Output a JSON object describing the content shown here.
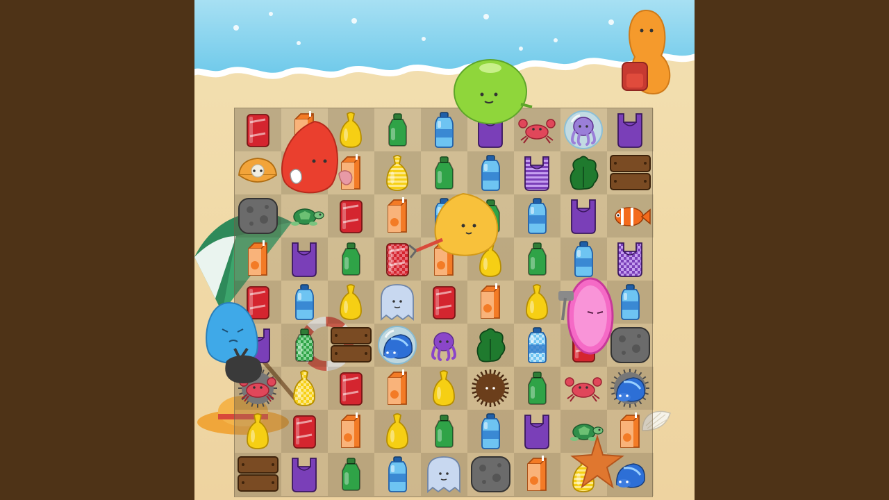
{
  "colors": {
    "frame": "#4e3317",
    "sand": "#f0d9a6",
    "sea": "#7fd1ef",
    "foam": "#ffffff"
  },
  "board": {
    "rows": 9,
    "cols": 9,
    "grid": [
      [
        "red-can",
        "orange-juice-box",
        "yellow-bag",
        "green-bottle",
        "blue-water-bottle",
        "purple-bag",
        "red-crab",
        "octopus-in-bubble",
        "purple-bag"
      ],
      [
        "clam-with-pearl",
        "orange-juice-box",
        "orange-juice-box",
        "yellow-striped-bag",
        "green-bottle",
        "blue-water-bottle",
        "purple-striped-bag",
        "green-seaweed",
        "wooden-plank"
      ],
      [
        "gray-rock",
        "sea-turtle",
        "red-can",
        "orange-juice-box",
        "blue-water-bottle",
        "green-bottle",
        "blue-water-bottle",
        "purple-bag",
        "clownfish"
      ],
      [
        "orange-juice-box",
        "purple-bag",
        "green-bottle",
        "red-can-checkered",
        "orange-juice-box",
        "yellow-bag",
        "green-bottle",
        "blue-water-bottle",
        "purple-bag-checkered"
      ],
      [
        "red-can",
        "blue-water-bottle",
        "yellow-bag",
        "ghost-jellyfish",
        "red-can",
        "orange-juice-box",
        "yellow-bag",
        "blue-water-bottle",
        "blue-water-bottle"
      ],
      [
        "purple-bag",
        "green-bottle-checkered",
        "wooden-plank",
        "hermit-crab-in-bubble",
        "purple-octopus",
        "green-seaweed",
        "blue-water-bottle-checkered",
        "red-can",
        "gray-rock"
      ],
      [
        "red-crab-in-urchin",
        "yellow-bag-checkered",
        "red-can",
        "orange-juice-box",
        "yellow-bag",
        "brown-urchin",
        "green-bottle",
        "red-crab",
        "hermit-crab-in-urchin"
      ],
      [
        "yellow-bag",
        "red-can",
        "orange-juice-box",
        "yellow-bag",
        "green-bottle",
        "blue-water-bottle",
        "purple-bag",
        "sea-turtle",
        "orange-juice-box"
      ],
      [
        "wooden-plank",
        "purple-bag",
        "green-bottle",
        "blue-water-bottle",
        "ghost-jellyfish",
        "gray-rock",
        "orange-juice-box",
        "yellow-striped-bag",
        "hermit-crab"
      ]
    ]
  },
  "characters": [
    {
      "name": "green-blob",
      "role": "helper"
    },
    {
      "name": "orange-blob-with-backpack",
      "role": "helper"
    },
    {
      "name": "red-blob-with-gloves",
      "role": "helper"
    },
    {
      "name": "yellow-blob-with-grabber",
      "role": "helper"
    },
    {
      "name": "blue-blob-with-trash-bag",
      "role": "helper"
    },
    {
      "name": "pink-blob-with-hammer",
      "role": "helper"
    }
  ],
  "decorations": [
    "beach-umbrella",
    "life-ring",
    "straw-hat",
    "seashell",
    "starfish"
  ]
}
